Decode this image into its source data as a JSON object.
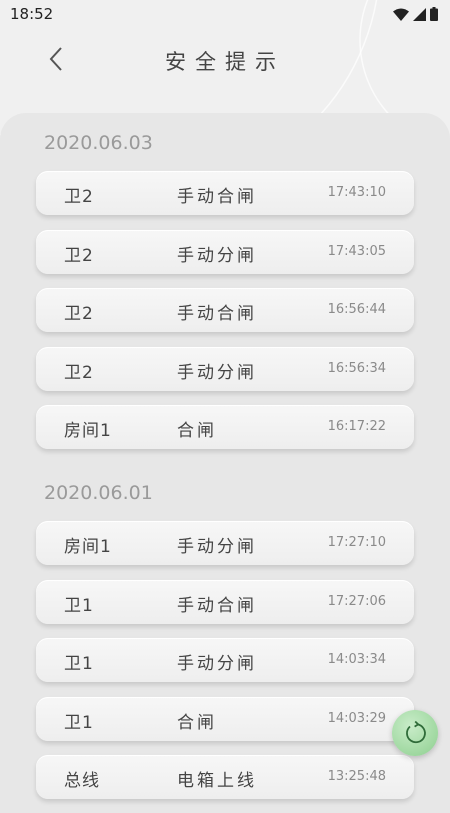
{
  "status_bar": {
    "time": "18:52"
  },
  "header": {
    "title": "安全提示",
    "back_icon": "chevron-left-icon"
  },
  "groups": [
    {
      "date": "2020.06.03",
      "records": [
        {
          "location": "卫2",
          "action": "手动合闸",
          "time": "17:43:10"
        },
        {
          "location": "卫2",
          "action": "手动分闸",
          "time": "17:43:05"
        },
        {
          "location": "卫2",
          "action": "手动合闸",
          "time": "16:56:44"
        },
        {
          "location": "卫2",
          "action": "手动分闸",
          "time": "16:56:34"
        },
        {
          "location": "房间1",
          "action": "合闸",
          "time": "16:17:22"
        }
      ]
    },
    {
      "date": "2020.06.01",
      "records": [
        {
          "location": "房间1",
          "action": "手动分闸",
          "time": "17:27:10"
        },
        {
          "location": "卫1",
          "action": "手动合闸",
          "time": "17:27:06"
        },
        {
          "location": "卫1",
          "action": "手动分闸",
          "time": "14:03:34"
        },
        {
          "location": "卫1",
          "action": "合闸",
          "time": "14:03:29"
        },
        {
          "location": "总线",
          "action": "电箱上线",
          "time": "13:25:48"
        }
      ]
    }
  ],
  "fab": {
    "icon": "refresh-icon"
  },
  "colors": {
    "accent": "#9fd8a0",
    "panel": "#e7e7e7",
    "background": "#f0f0f0"
  }
}
